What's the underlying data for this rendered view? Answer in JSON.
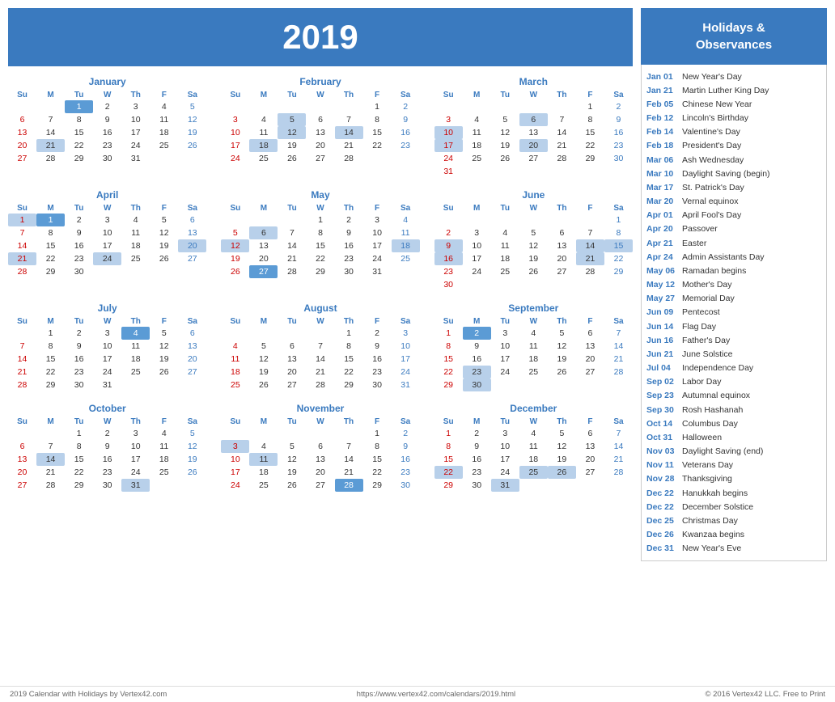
{
  "header": {
    "year": "2019",
    "bg_color": "#3a7abf"
  },
  "holidays_panel": {
    "title": "Holidays &\nObservances",
    "items": [
      {
        "date": "Jan 01",
        "name": "New Year's Day"
      },
      {
        "date": "Jan 21",
        "name": "Martin Luther King Day"
      },
      {
        "date": "Feb 05",
        "name": "Chinese New Year"
      },
      {
        "date": "Feb 12",
        "name": "Lincoln's Birthday"
      },
      {
        "date": "Feb 14",
        "name": "Valentine's Day"
      },
      {
        "date": "Feb 18",
        "name": "President's Day"
      },
      {
        "date": "Mar 06",
        "name": "Ash Wednesday"
      },
      {
        "date": "Mar 10",
        "name": "Daylight Saving (begin)"
      },
      {
        "date": "Mar 17",
        "name": "St. Patrick's Day"
      },
      {
        "date": "Mar 20",
        "name": "Vernal equinox"
      },
      {
        "date": "Apr 01",
        "name": "April Fool's Day"
      },
      {
        "date": "Apr 20",
        "name": "Passover"
      },
      {
        "date": "Apr 21",
        "name": "Easter"
      },
      {
        "date": "Apr 24",
        "name": "Admin Assistants Day"
      },
      {
        "date": "May 06",
        "name": "Ramadan begins"
      },
      {
        "date": "May 12",
        "name": "Mother's Day"
      },
      {
        "date": "May 27",
        "name": "Memorial Day"
      },
      {
        "date": "Jun 09",
        "name": "Pentecost"
      },
      {
        "date": "Jun 14",
        "name": "Flag Day"
      },
      {
        "date": "Jun 16",
        "name": "Father's Day"
      },
      {
        "date": "Jun 21",
        "name": "June Solstice"
      },
      {
        "date": "Jul 04",
        "name": "Independence Day"
      },
      {
        "date": "Sep 02",
        "name": "Labor Day"
      },
      {
        "date": "Sep 23",
        "name": "Autumnal equinox"
      },
      {
        "date": "Sep 30",
        "name": "Rosh Hashanah"
      },
      {
        "date": "Oct 14",
        "name": "Columbus Day"
      },
      {
        "date": "Oct 31",
        "name": "Halloween"
      },
      {
        "date": "Nov 03",
        "name": "Daylight Saving (end)"
      },
      {
        "date": "Nov 11",
        "name": "Veterans Day"
      },
      {
        "date": "Nov 28",
        "name": "Thanksgiving"
      },
      {
        "date": "Dec 22",
        "name": "Hanukkah begins"
      },
      {
        "date": "Dec 22",
        "name": "December Solstice"
      },
      {
        "date": "Dec 25",
        "name": "Christmas Day"
      },
      {
        "date": "Dec 26",
        "name": "Kwanzaa begins"
      },
      {
        "date": "Dec 31",
        "name": "New Year's Eve"
      }
    ]
  },
  "footer": {
    "left": "2019 Calendar with Holidays by Vertex42.com",
    "center": "https://www.vertex42.com/calendars/2019.html",
    "right": "© 2016 Vertex42 LLC. Free to Print"
  }
}
